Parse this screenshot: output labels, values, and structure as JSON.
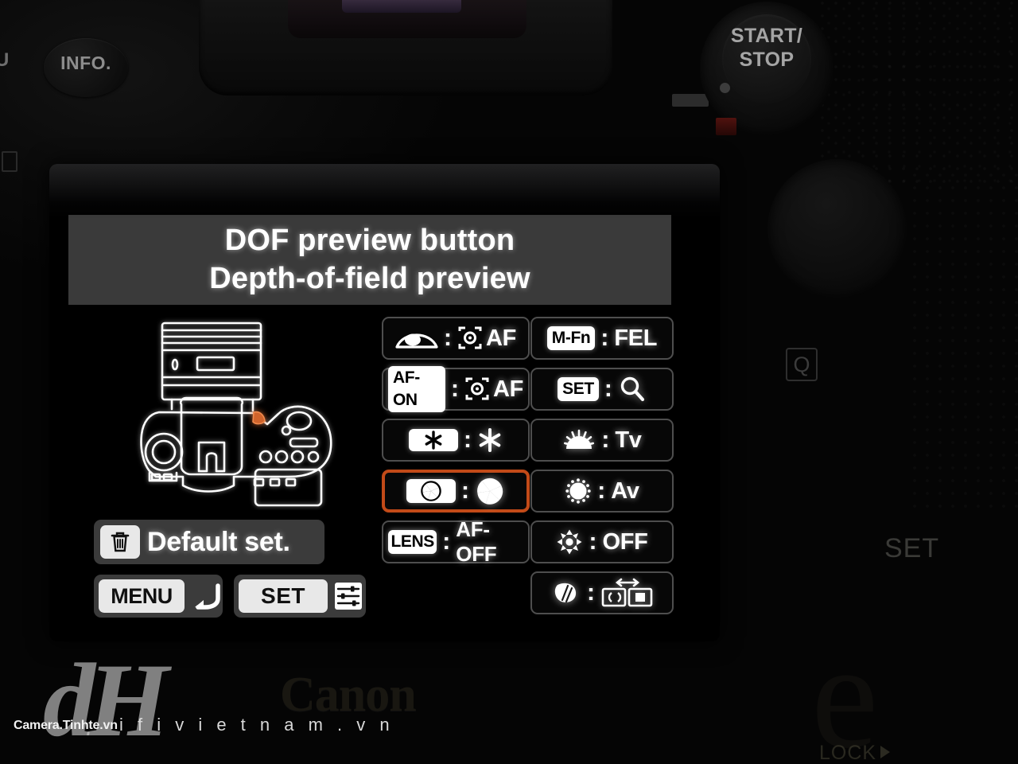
{
  "camera_body": {
    "info_button_label": "INFO.",
    "partial_left_label": "U",
    "start_stop_label": "START/\nSTOP",
    "start_label": "START/",
    "stop_label": "STOP",
    "quick_menu_label": "Q",
    "set_label": "SET",
    "lock_label": "LOCK",
    "brand_label": "Canon"
  },
  "screen": {
    "title": {
      "line1": "DOF preview button",
      "line2": "Depth-of-field preview",
      "background_color": "#3a3a3a"
    },
    "diagram": {
      "name": "camera-top-view-diagram",
      "highlight_color": "#d1642c",
      "highlight_note": "DOF preview button location"
    },
    "accent_color": "#c24a18",
    "left_column": [
      {
        "id": "shutter-button",
        "control_icon": "shutter-half-press-icon",
        "control_label": "",
        "separator": ":",
        "function_icon": "metering-af-start-icon",
        "function_label": "AF",
        "selected": false
      },
      {
        "id": "af-on-button",
        "control_icon": "af-on-tag",
        "control_label": "AF-ON",
        "separator": ":",
        "function_icon": "metering-af-start-icon",
        "function_label": "AF",
        "selected": false
      },
      {
        "id": "ae-lock-button",
        "control_icon": "asterisk-tag",
        "control_label": "✱",
        "separator": ":",
        "function_icon": "asterisk-icon",
        "function_label": "✱",
        "selected": false
      },
      {
        "id": "dof-preview-button",
        "control_icon": "aperture-tag",
        "control_label": "",
        "separator": ":",
        "function_icon": "aperture-icon",
        "function_label": "",
        "selected": true
      },
      {
        "id": "lens-af-stop-button",
        "control_icon": "lens-tag",
        "control_label": "LENS",
        "separator": ":",
        "function_icon": "",
        "function_label": "AF-OFF",
        "selected": false
      }
    ],
    "right_column": [
      {
        "id": "m-fn-button",
        "control_icon": "m-fn-tag",
        "control_label": "M-Fn",
        "separator": ":",
        "function_icon": "",
        "function_label": "FEL",
        "selected": false
      },
      {
        "id": "set-button",
        "control_icon": "set-tag",
        "control_label": "SET",
        "separator": ":",
        "function_icon": "magnifier-icon",
        "function_label": "",
        "selected": false
      },
      {
        "id": "main-dial",
        "control_icon": "main-dial-icon",
        "control_label": "",
        "separator": ":",
        "function_icon": "",
        "function_label": "Tv",
        "selected": false
      },
      {
        "id": "quick-control-dial",
        "control_icon": "quick-control-dial-icon",
        "control_label": "",
        "separator": ":",
        "function_icon": "",
        "function_label": "Av",
        "selected": false
      },
      {
        "id": "multi-controller",
        "control_icon": "multi-controller-icon",
        "control_label": "",
        "separator": ":",
        "function_icon": "",
        "function_label": "OFF",
        "selected": false
      },
      {
        "id": "lens-button",
        "control_icon": "lens-button-icon",
        "control_label": "",
        "separator": ":",
        "function_icon": "af-area-switch-icon",
        "function_label": "",
        "selected": false
      }
    ],
    "footer": {
      "default_set_label": "Default set.",
      "default_set_icon": "trash-icon",
      "menu_label": "MENU",
      "menu_icon": "return-arrow-icon",
      "set_label": "SET",
      "set_icon": "settings-sliders-icon"
    }
  },
  "watermarks": {
    "logo": "dH",
    "site_primary": "Camera.Tinhte.vn",
    "site_secondary": "i f i v i e t n a m . v n"
  }
}
